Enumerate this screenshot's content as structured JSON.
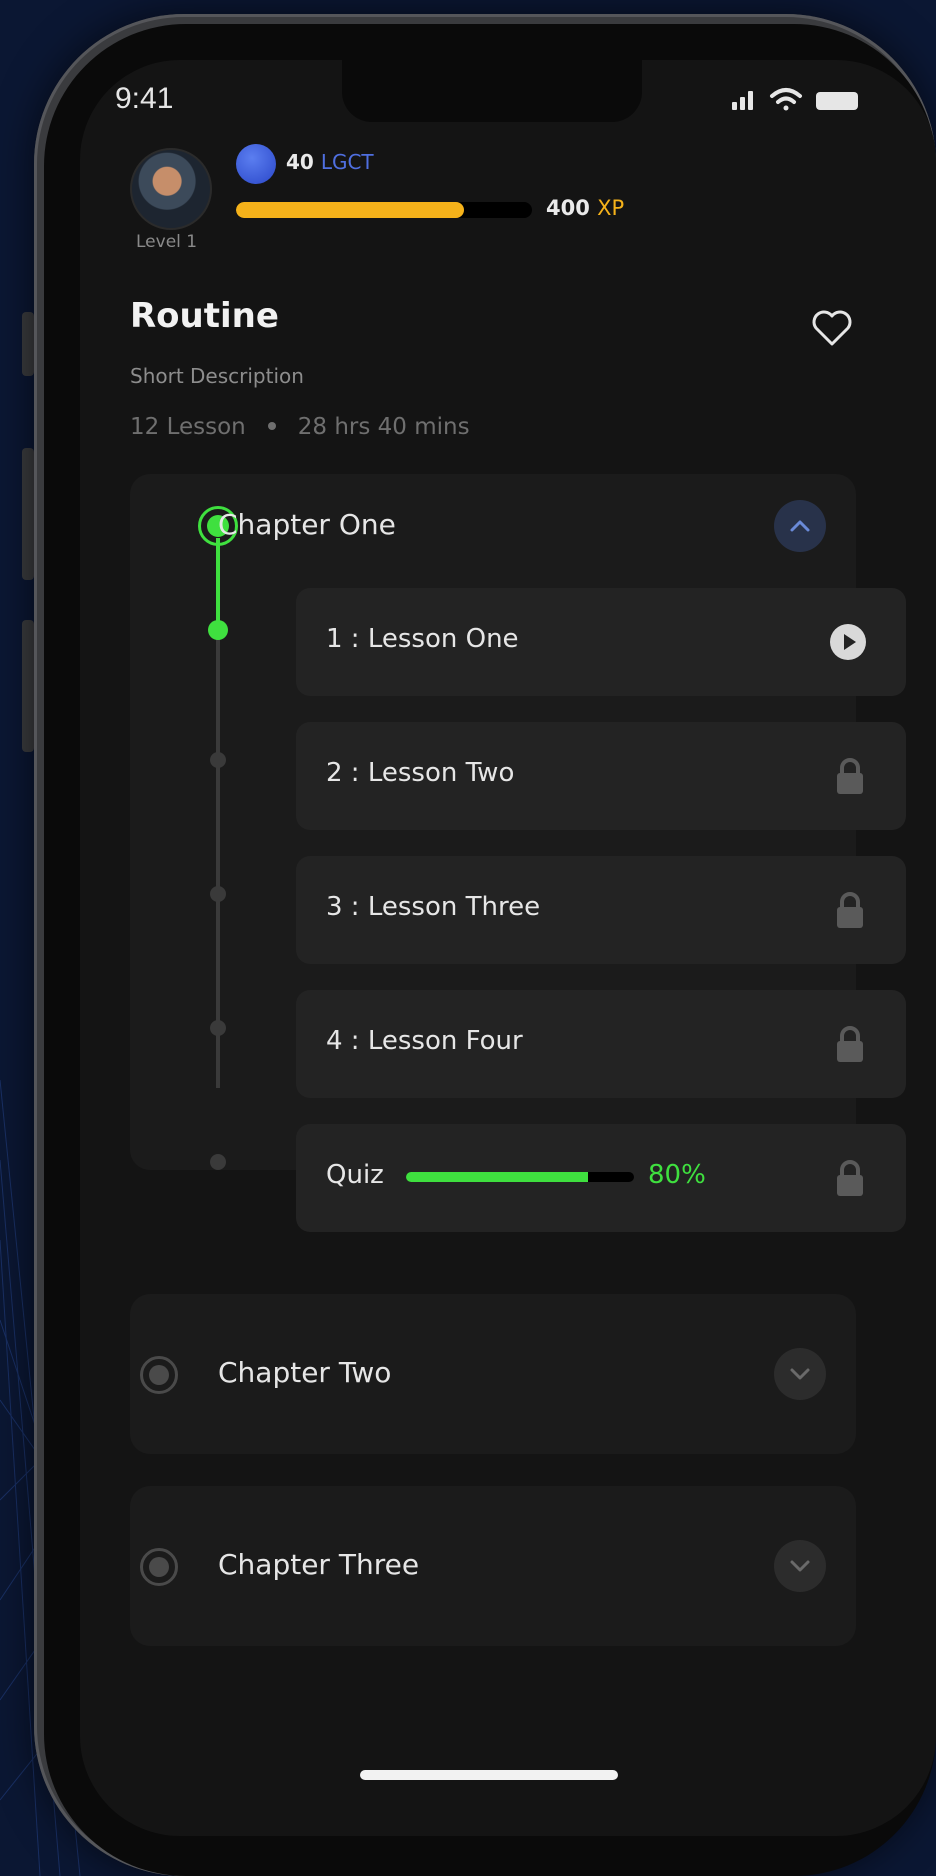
{
  "status_bar": {
    "time": "9:41"
  },
  "profile": {
    "level": "Level 1",
    "token_amount": "40",
    "token_unit": "LGCT",
    "xp_amount": "400",
    "xp_unit": "XP",
    "xp_progress": 0.77
  },
  "course": {
    "title": "Routine",
    "description": "Short Description",
    "lessons_count": "12 Lesson",
    "duration": "28 hrs 40 mins"
  },
  "chapters": [
    {
      "title": "Chapter One",
      "expanded": true,
      "lessons": [
        {
          "label": "1 : Lesson One",
          "status": "play"
        },
        {
          "label": "2 : Lesson Two",
          "status": "locked"
        },
        {
          "label": "3 : Lesson Three",
          "status": "locked"
        },
        {
          "label": "4 : Lesson Four",
          "status": "locked"
        }
      ],
      "quiz": {
        "label": "Quiz",
        "progress_text": "80%",
        "progress": 0.8,
        "status": "locked"
      }
    },
    {
      "title": "Chapter Two",
      "expanded": false
    },
    {
      "title": "Chapter Three",
      "expanded": false
    }
  ],
  "colors": {
    "accent_green": "#3fe03f",
    "xp_yellow": "#f5b21a",
    "token_blue": "#4f6fe0",
    "background": "#141414"
  }
}
